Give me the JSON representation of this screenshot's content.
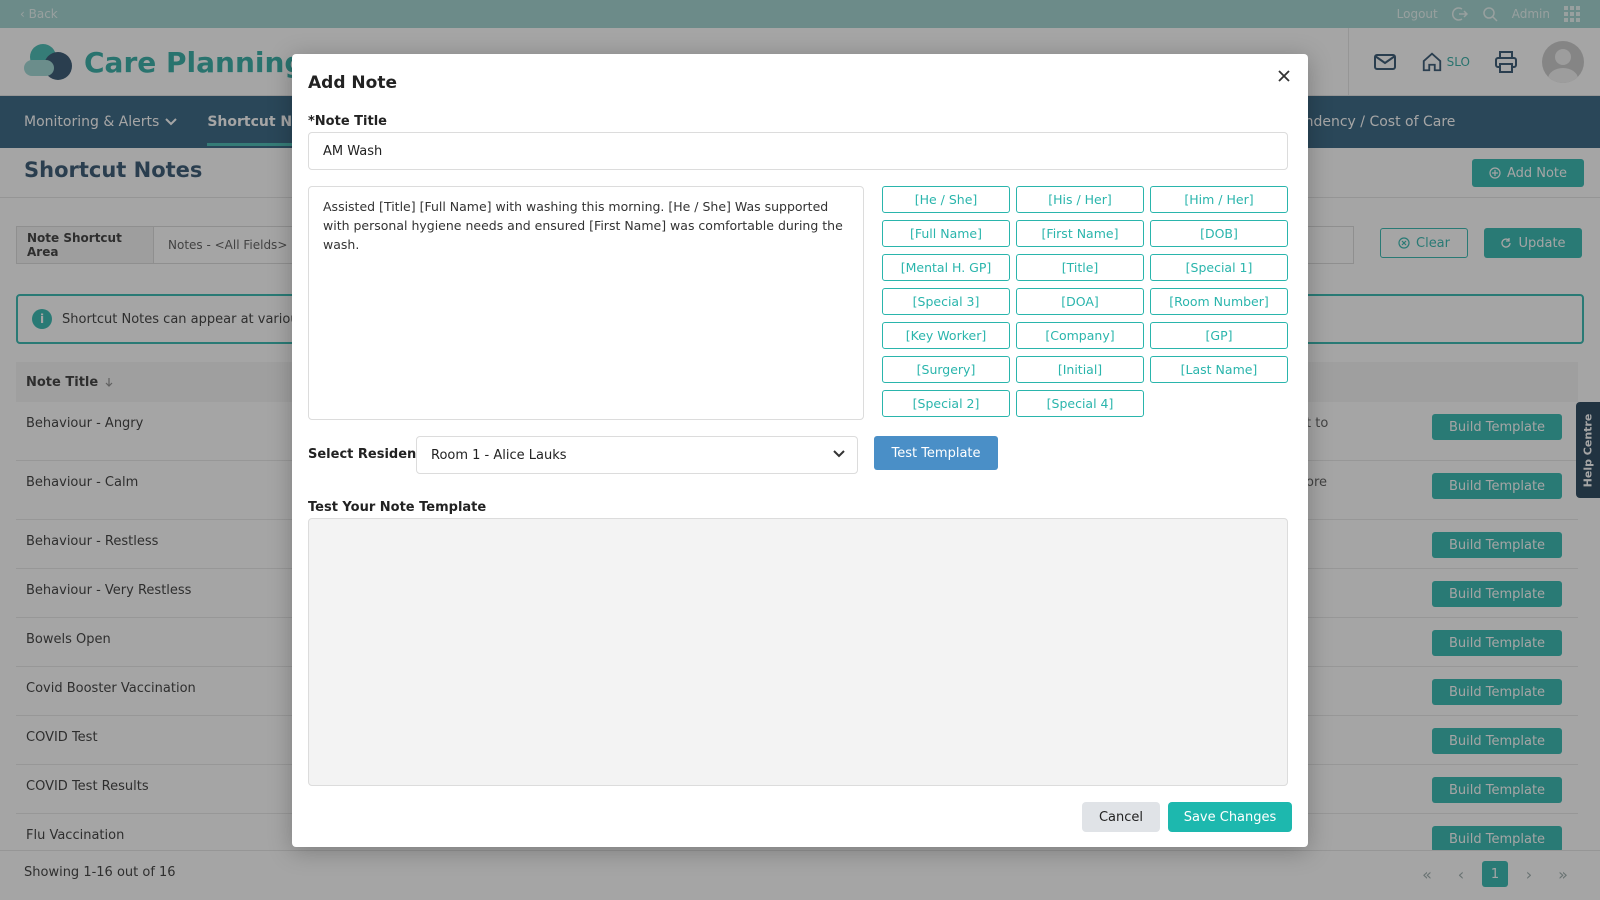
{
  "topbar": {
    "back": "‹ Back",
    "logout": "Logout",
    "user": "Admin"
  },
  "header": {
    "app_title": "Care Planning",
    "home_label": "SLO"
  },
  "nav": {
    "items": [
      {
        "label": "Monitoring & Alerts",
        "has_dropdown": true
      },
      {
        "label": "Shortcut Notes",
        "active": true
      }
    ],
    "right_fragment": "endency / Cost of Care"
  },
  "page": {
    "title": "Shortcut Notes",
    "add_note_label": "Add Note",
    "filter": {
      "label": "Note Shortcut Area",
      "value": "Notes - <All Fields>"
    },
    "clear_label": "Clear",
    "update_label": "Update",
    "info_text": "Shortcut Notes can appear at various",
    "table": {
      "column_title": "Note Title",
      "rows": [
        {
          "title": "Behaviour - Angry",
          "fragment": "t to"
        },
        {
          "title": "Behaviour - Calm",
          "fragment": "ore"
        },
        {
          "title": "Behaviour - Restless",
          "fragment": ""
        },
        {
          "title": "Behaviour - Very Restless",
          "fragment": ""
        },
        {
          "title": "Bowels Open",
          "fragment": ""
        },
        {
          "title": "Covid Booster Vaccination",
          "fragment": ""
        },
        {
          "title": "COVID Test",
          "fragment": ""
        },
        {
          "title": "COVID Test Results",
          "fragment": ""
        },
        {
          "title": "Flu Vaccination",
          "fragment": ""
        }
      ],
      "build_label": "Build Template"
    },
    "help_tab": "Help Centre",
    "footer": {
      "showing": "Showing 1-16 out of 16",
      "current_page": "1"
    }
  },
  "modal": {
    "title": "Add Note",
    "note_title_label": "*Note Title",
    "note_title_value": "AM Wash",
    "body_text": "Assisted [Title] [Full Name] with washing this morning. [He / She] Was supported with personal hygiene needs and ensured [First Name] was comfortable during the wash.",
    "tokens": [
      "[He / She]",
      "[His / Her]",
      "[Him / Her]",
      "[Full Name]",
      "[First Name]",
      "[DOB]",
      "[Mental H. GP]",
      "[Title]",
      "[Special 1]",
      "[Special 3]",
      "[DOA]",
      "[Room Number]",
      "[Key Worker]",
      "[Company]",
      "[GP]",
      "[Surgery]",
      "[Initial]",
      "[Last Name]",
      "[Special 2]",
      "[Special 4]"
    ],
    "select_resident_label": "Select Resident:",
    "resident_value": "Room 1 - Alice Lauks",
    "test_template_label": "Test Template",
    "test_area_label": "Test Your Note Template",
    "cancel_label": "Cancel",
    "save_label": "Save Changes"
  },
  "colors": {
    "accent": "#2ab5ac",
    "nav": "#2c5d7c",
    "test_button": "#4a8fc7"
  }
}
